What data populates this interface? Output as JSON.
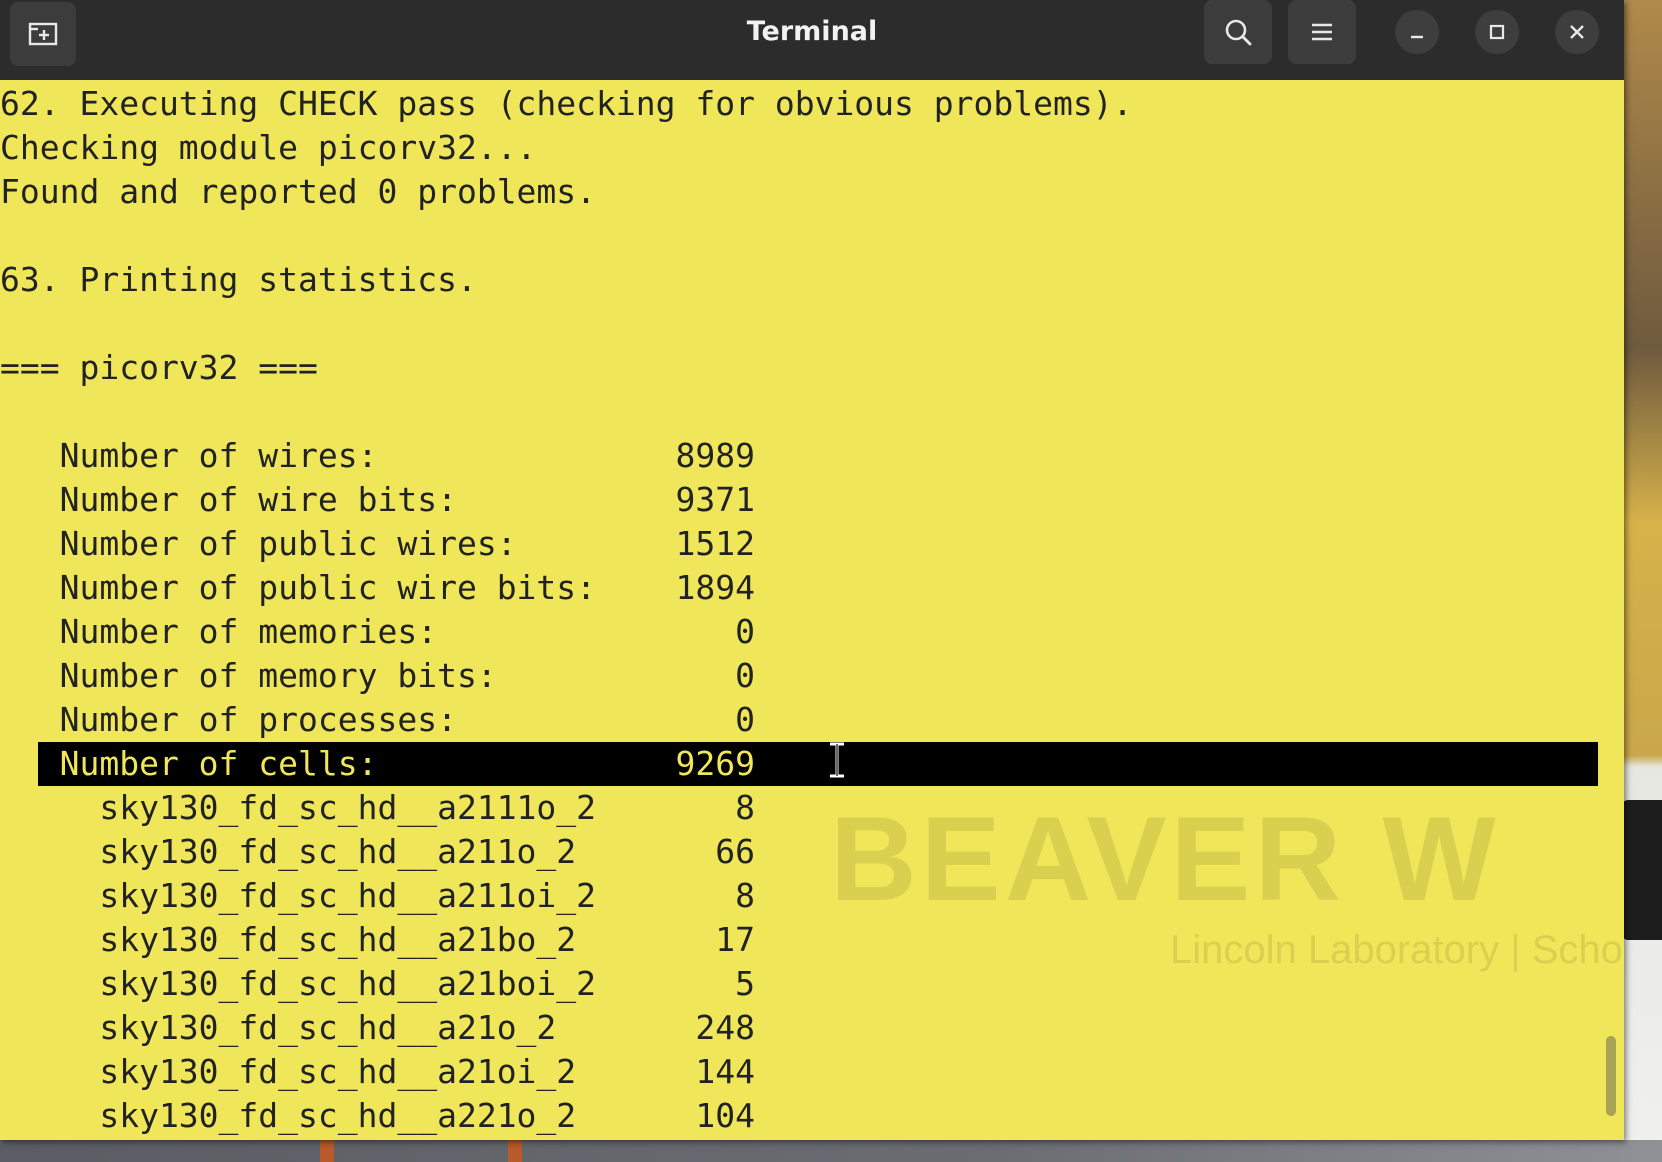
{
  "window": {
    "title": "Terminal"
  },
  "icons": {
    "new_tab": "new-tab-icon",
    "search": "search-icon",
    "menu": "hamburger-menu-icon",
    "minimize": "minimize-icon",
    "maximize": "maximize-icon",
    "close": "close-icon",
    "cursor": "text-cursor-icon"
  },
  "colors": {
    "terminal_background": "#efe65a",
    "terminal_text": "#222222",
    "highlight_background": "#000000",
    "titlebar": "#2c2c2c"
  },
  "terminal": {
    "lines": [
      "62. Executing CHECK pass (checking for obvious problems).",
      "Checking module picorv32...",
      "Found and reported 0 problems.",
      "",
      "63. Printing statistics.",
      "",
      "=== picorv32 ===",
      "",
      "   Number of wires:               8989",
      "   Number of wire bits:           9371",
      "   Number of public wires:        1512",
      "   Number of public wire bits:    1894",
      "   Number of memories:               0",
      "   Number of memory bits:            0",
      "   Number of processes:              0",
      "   Number of cells:               9269",
      "     sky130_fd_sc_hd__a2111o_2       8",
      "     sky130_fd_sc_hd__a211o_2       66",
      "     sky130_fd_sc_hd__a211oi_2       8",
      "     sky130_fd_sc_hd__a21bo_2       17",
      "     sky130_fd_sc_hd__a21boi_2       5",
      "     sky130_fd_sc_hd__a21o_2       248",
      "     sky130_fd_sc_hd__a21oi_2      144",
      "     sky130_fd_sc_hd__a221o_2      104"
    ],
    "highlighted_line_index": 15
  },
  "wallpaper": {
    "watermark_title": "BEAVER W",
    "watermark_subtitle": "Lincoln Laboratory | School o"
  }
}
